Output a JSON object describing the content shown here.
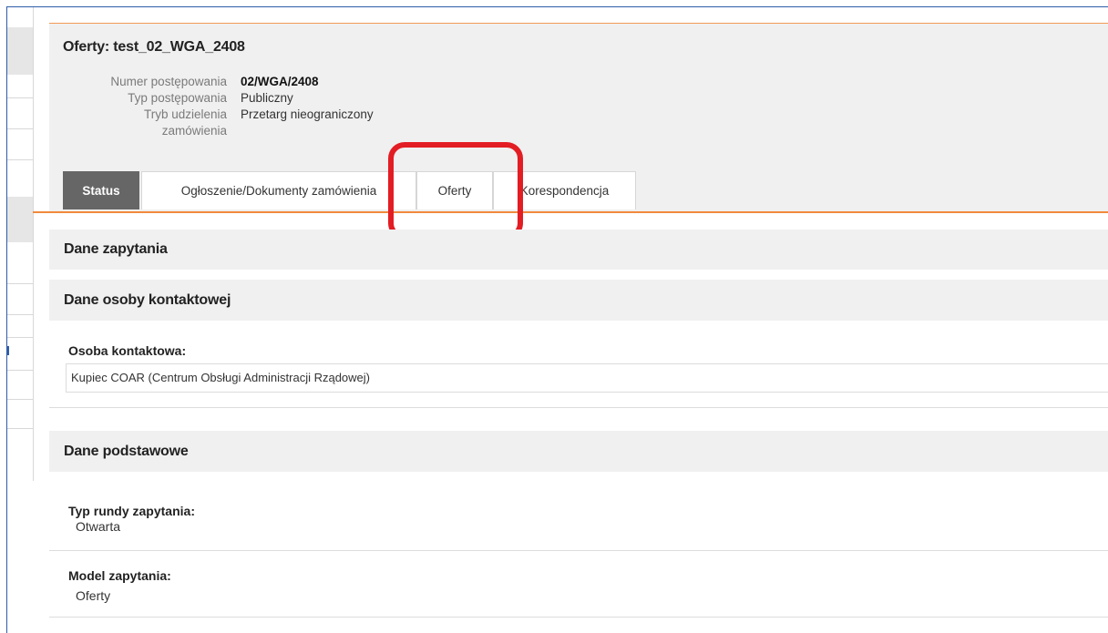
{
  "header": {
    "title": "Oferty: test_02_WGA_2408",
    "meta": {
      "number_label": "Numer postępowania",
      "number_value": "02/WGA/2408",
      "type_label": "Typ postępowania",
      "type_value": "Publiczny",
      "mode_label_line1": "Tryb udzielenia",
      "mode_label_line2": "zamówienia",
      "mode_value": "Przetarg nieograniczony"
    }
  },
  "tabs": [
    {
      "label": "Status",
      "active": true
    },
    {
      "label": "Ogłoszenie/Dokumenty zamówienia",
      "active": false
    },
    {
      "label": "Oferty",
      "active": false
    },
    {
      "label": "Korespondencja",
      "active": false
    }
  ],
  "sections": {
    "query_data": "Dane zapytania",
    "contact_data": "Dane osoby kontaktowej",
    "basic_data": "Dane podstawowe"
  },
  "contact": {
    "label": "Osoba kontaktowa:",
    "value": "Kupiec COAR (Centrum Obsługi Administracji Rządowej)"
  },
  "basic": {
    "round_type_label": "Typ rundy zapytania:",
    "round_type_value": "Otwarta",
    "model_label": "Model zapytania:",
    "model_value": "Oferty"
  },
  "colors": {
    "accent_orange": "#f08a3c",
    "frame_blue": "#2f5da8",
    "highlight_red": "#e31d24",
    "active_tab": "#666666"
  }
}
